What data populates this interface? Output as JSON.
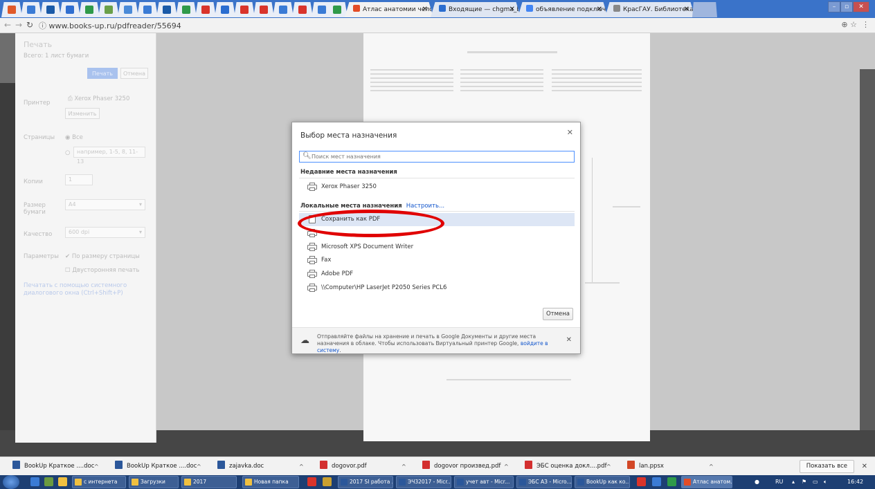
{
  "browser": {
    "active_tab_title": "Атлас анатомии челове",
    "tabs_right": [
      {
        "title": "Входящие — chgma_bl",
        "icon_color": "#2a6dd0"
      },
      {
        "title": "объявление подключен",
        "icon_color": "#4285f4",
        "icon_glyph": "G"
      },
      {
        "title": "КрасГАУ. Библиотека/",
        "icon_color": "#888888"
      }
    ],
    "address": "www.books-up.ru/pdfreader/55694"
  },
  "print_panel": {
    "title": "Печать",
    "total": "Всего: 1 лист бумаги",
    "print_button": "Печать",
    "cancel_button": "Отмена",
    "printer_label": "Принтер",
    "printer_name": "Xerox Phaser 3250",
    "change_button": "Изменить",
    "pages_label": "Страницы",
    "pages_all": "Все",
    "pages_placeholder": "например, 1-5, 8, 11-13",
    "copies_label": "Копии",
    "copies_value": "1",
    "paper_label": "Размер бумаги",
    "paper_value": "A4",
    "quality_label": "Качество",
    "quality_value": "600 dpi",
    "options_label": "Параметры",
    "fit_option": "По размеру страницы",
    "duplex_option": "Двусторонняя печать",
    "system_dialog": "Печатать с помощью системного диалогового окна (Ctrl+Shift+P)"
  },
  "dialog": {
    "title": "Выбор места назначения",
    "search_placeholder": "Поиск мест назначения",
    "recent_header": "Недавние места назначения",
    "recent": [
      {
        "label": "Xerox Phaser 3250",
        "icon": "printer-icon"
      }
    ],
    "local_header": "Локальные места назначения",
    "local_link": "Настроить...",
    "local": [
      {
        "label": "Сохранить как PDF",
        "icon": "pdf-file-icon",
        "selected": true
      },
      {
        "label": "",
        "icon": "printer-icon"
      },
      {
        "label": "Microsoft XPS Document Writer",
        "icon": "printer-icon"
      },
      {
        "label": "Fax",
        "icon": "printer-icon"
      },
      {
        "label": "Adobe PDF",
        "icon": "printer-icon"
      },
      {
        "label": "\\\\Computer\\HP LaserJet P2050 Series PCL6",
        "icon": "printer-icon"
      }
    ],
    "cancel": "Отмена",
    "footer_text": "Отправляйте файлы на хранение и печать в Google Документы и другие места назначения в облаке. Чтобы использовать Виртуальный принтер Google,",
    "footer_link": "войдите в систему",
    "footer_end": "."
  },
  "downloads": {
    "items": [
      {
        "name": "BookUp Краткое ....doc",
        "icon_color": "#2b579a"
      },
      {
        "name": "BookUp Краткое ....doc",
        "icon_color": "#2b579a"
      },
      {
        "name": "zajavka.doc",
        "icon_color": "#2b579a"
      },
      {
        "name": "dogovor.pdf",
        "icon_color": "#d32f2f"
      },
      {
        "name": "dogovor произвед.pdf",
        "icon_color": "#d32f2f"
      },
      {
        "name": "ЭБС оценка докл....pdf",
        "icon_color": "#d32f2f"
      },
      {
        "name": "lan.ppsx",
        "icon_color": "#d24726"
      }
    ],
    "show_all": "Показать все"
  },
  "taskbar": {
    "items": [
      {
        "label": "с интернета",
        "icon_color": "#f0c040"
      },
      {
        "label": "Загрузки",
        "icon_color": "#f0c040"
      },
      {
        "label": "2017",
        "icon_color": "#f0c040"
      },
      {
        "label": "Новая папка",
        "icon_color": "#f0c040"
      },
      {
        "label": "2017 SI работа ...",
        "icon_color": "#2b579a"
      },
      {
        "label": "ЭЧ32017 - Micr...",
        "icon_color": "#2b579a"
      },
      {
        "label": "учет авт - Micr...",
        "icon_color": "#2b579a"
      },
      {
        "label": "ЭБС АЗ - Micro...",
        "icon_color": "#2b579a"
      },
      {
        "label": "BookUp как ко...",
        "icon_color": "#2b579a"
      },
      {
        "label": "Атлас анатом...",
        "icon_color": "#e34c26"
      }
    ],
    "lang": "RU",
    "time": "16:42"
  }
}
